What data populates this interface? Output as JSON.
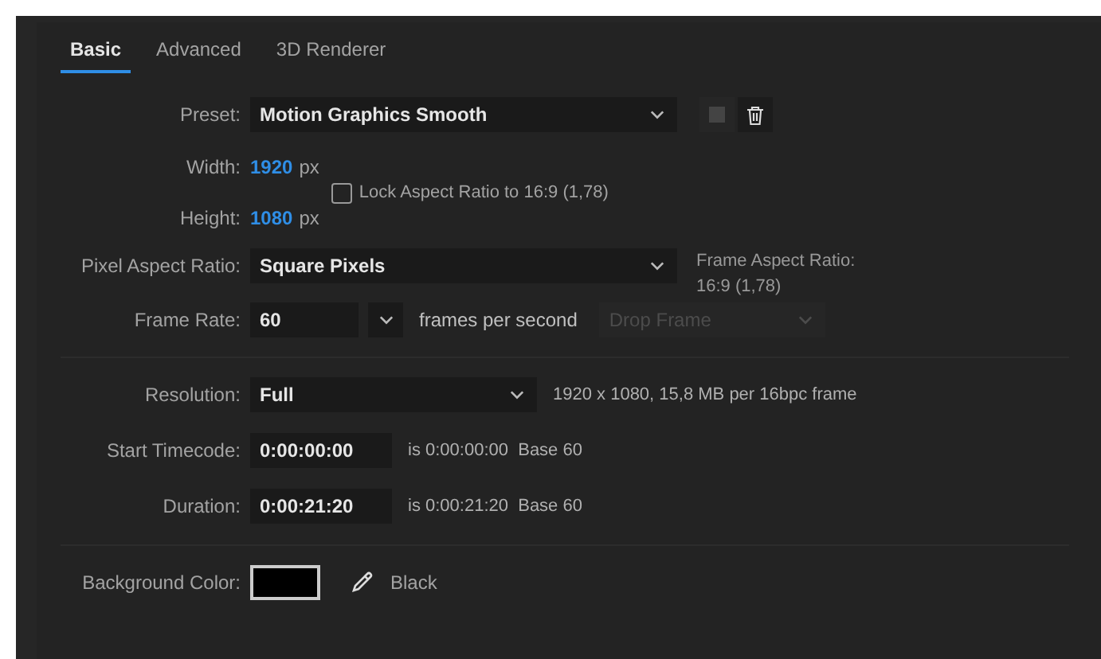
{
  "tabs": [
    {
      "label": "Basic",
      "selected": true
    },
    {
      "label": "Advanced",
      "selected": false
    },
    {
      "label": "3D Renderer",
      "selected": false
    }
  ],
  "preset": {
    "label": "Preset:",
    "value": "Motion Graphics Smooth",
    "save_disabled": true
  },
  "width": {
    "label": "Width:",
    "value": "1920",
    "unit": "px"
  },
  "height": {
    "label": "Height:",
    "value": "1080",
    "unit": "px"
  },
  "lock_aspect": {
    "label": "Lock Aspect Ratio to 16:9 (1,78)",
    "checked": false
  },
  "pixel_aspect_ratio": {
    "label": "Pixel Aspect Ratio:",
    "value": "Square Pixels"
  },
  "frame_aspect_ratio": {
    "label": "Frame Aspect Ratio:",
    "value": "16:9 (1,78)"
  },
  "frame_rate": {
    "label": "Frame Rate:",
    "value": "60",
    "unit": "frames per second",
    "drop_frame": {
      "value": "Drop Frame",
      "disabled": true
    }
  },
  "resolution": {
    "label": "Resolution:",
    "value": "Full",
    "info": "1920 x 1080, 15,8 MB per 16bpc frame"
  },
  "start_timecode": {
    "label": "Start Timecode:",
    "value": "0:00:00:00",
    "info": "is 0:00:00:00  Base 60"
  },
  "duration": {
    "label": "Duration:",
    "value": "0:00:21:20",
    "info": "is 0:00:21:20  Base 60"
  },
  "background_color": {
    "label": "Background Color:",
    "color": "#000000",
    "name": "Black"
  }
}
